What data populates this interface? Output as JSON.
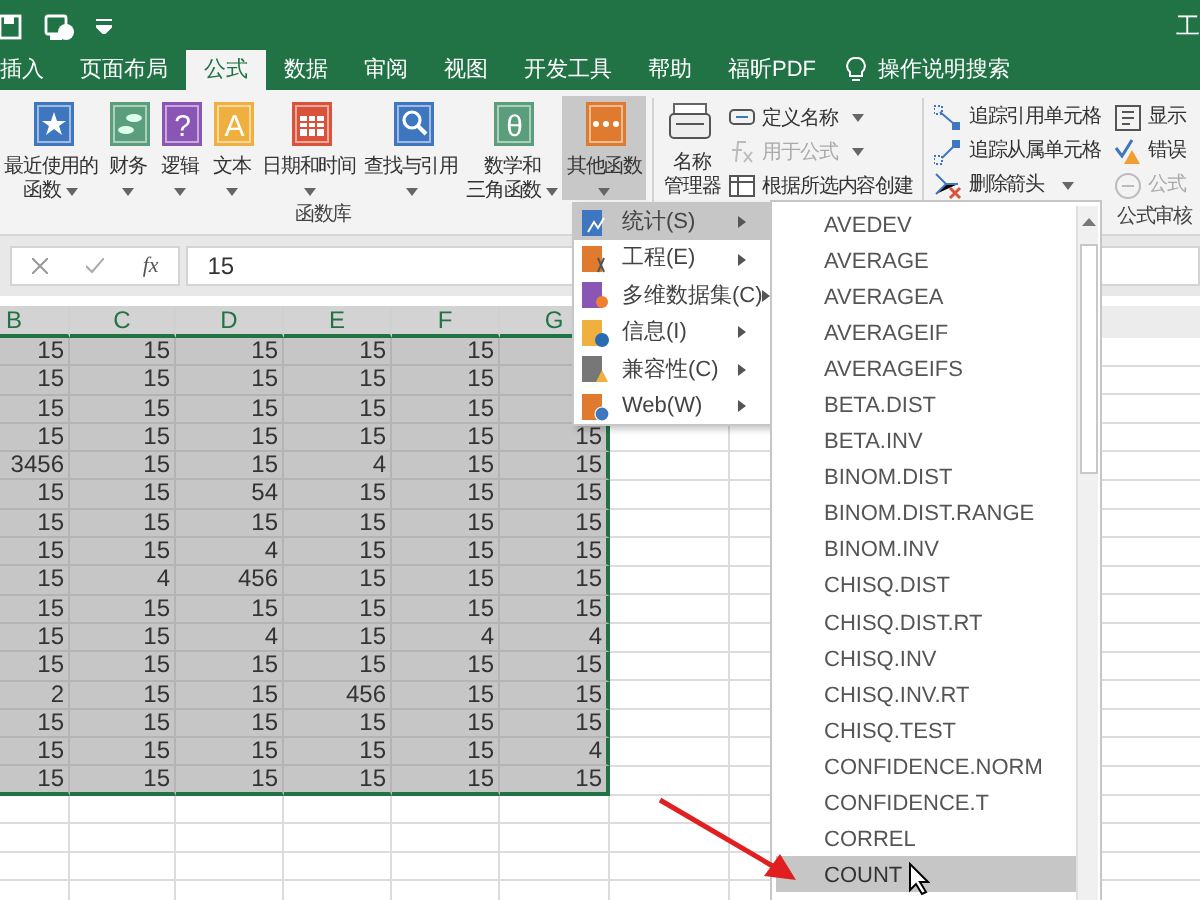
{
  "title_bar": {
    "title": "工"
  },
  "tabs": [
    {
      "label": "插入",
      "selected": false
    },
    {
      "label": "页面布局",
      "selected": false
    },
    {
      "label": "公式",
      "selected": true
    },
    {
      "label": "数据",
      "selected": false
    },
    {
      "label": "审阅",
      "selected": false
    },
    {
      "label": "视图",
      "selected": false
    },
    {
      "label": "开发工具",
      "selected": false
    },
    {
      "label": "帮助",
      "selected": false
    },
    {
      "label": "福昕PDF",
      "selected": false
    }
  ],
  "tell_me": {
    "label": "操作说明搜索"
  },
  "function_library": {
    "label": "函数库",
    "buttons": [
      {
        "lines": [
          "最近使用的",
          "函数"
        ],
        "selected": false
      },
      {
        "lines": [
          "财务"
        ],
        "selected": false
      },
      {
        "lines": [
          "逻辑"
        ],
        "glyph": "?",
        "selected": false
      },
      {
        "lines": [
          "文本"
        ],
        "glyph": "A",
        "selected": false
      },
      {
        "lines": [
          "日期和时间"
        ],
        "selected": false
      },
      {
        "lines": [
          "查找与引用"
        ],
        "selected": false
      },
      {
        "lines": [
          "数学和",
          "三角函数"
        ],
        "glyph": "θ",
        "selected": false
      },
      {
        "lines": [
          "其他函数"
        ],
        "selected": true
      }
    ]
  },
  "defined_names": {
    "manager": [
      "名称",
      "管理器"
    ],
    "items": [
      {
        "label": "定义名称",
        "dropdown": true,
        "disabled": false
      },
      {
        "label": "用于公式",
        "dropdown": true,
        "disabled": true
      },
      {
        "label": "根据所选内容创建",
        "dropdown": false,
        "disabled": false
      }
    ]
  },
  "formula_auditing": {
    "label": "公式审核",
    "items": [
      {
        "label": "追踪引用单元格",
        "disabled": false
      },
      {
        "label": "追踪从属单元格",
        "disabled": false
      },
      {
        "label": "删除箭头",
        "dropdown": true,
        "disabled": false
      }
    ],
    "more": [
      {
        "label": "显示",
        "disabled": false
      },
      {
        "label": "错误",
        "disabled": false
      },
      {
        "label": "公式",
        "disabled": true
      }
    ]
  },
  "formula_bar": {
    "fx_label": "fx",
    "value": "15"
  },
  "sheet": {
    "columns": [
      "B",
      "C",
      "D",
      "E",
      "F",
      "G"
    ],
    "rows": [
      {
        "selected": true,
        "cells": [
          "15",
          "15",
          "15",
          "15",
          "15"
        ]
      },
      {
        "selected": true,
        "cells": [
          "15",
          "15",
          "15",
          "15",
          "15"
        ]
      },
      {
        "selected": true,
        "cells": [
          "15",
          "15",
          "15",
          "15",
          "15"
        ]
      },
      {
        "selected": true,
        "cells": [
          "15",
          "15",
          "15",
          "15",
          "15",
          "15"
        ]
      },
      {
        "selected": true,
        "cells": [
          "3456",
          "15",
          "15",
          "4",
          "15",
          "15"
        ]
      },
      {
        "selected": true,
        "cells": [
          "15",
          "15",
          "54",
          "15",
          "15",
          "15"
        ]
      },
      {
        "selected": true,
        "cells": [
          "15",
          "15",
          "15",
          "15",
          "15",
          "15"
        ]
      },
      {
        "selected": true,
        "cells": [
          "15",
          "15",
          "4",
          "15",
          "15",
          "15"
        ]
      },
      {
        "selected": true,
        "cells": [
          "15",
          "4",
          "456",
          "15",
          "15",
          "15"
        ]
      },
      {
        "selected": true,
        "cells": [
          "15",
          "15",
          "15",
          "15",
          "15",
          "15"
        ]
      },
      {
        "selected": true,
        "cells": [
          "15",
          "15",
          "4",
          "15",
          "4",
          "4"
        ]
      },
      {
        "selected": true,
        "cells": [
          "15",
          "15",
          "15",
          "15",
          "15",
          "15"
        ]
      },
      {
        "selected": true,
        "cells": [
          "2",
          "15",
          "15",
          "456",
          "15",
          "15"
        ]
      },
      {
        "selected": true,
        "cells": [
          "15",
          "15",
          "15",
          "15",
          "15",
          "15"
        ]
      },
      {
        "selected": true,
        "cells": [
          "15",
          "15",
          "15",
          "15",
          "15",
          "4"
        ]
      },
      {
        "selected": true,
        "cells": [
          "15",
          "15",
          "15",
          "15",
          "15",
          "15"
        ]
      }
    ]
  },
  "function_menu": {
    "items": [
      {
        "label": "统计(S)",
        "selected": true
      },
      {
        "label": "工程(E)",
        "selected": false
      },
      {
        "label": "多维数据集(C)",
        "selected": false
      },
      {
        "label": "信息(I)",
        "selected": false
      },
      {
        "label": "兼容性(C)",
        "selected": false
      },
      {
        "label": "Web(W)",
        "selected": false
      }
    ]
  },
  "statistical_menu": {
    "items": [
      {
        "label": "AVEDEV",
        "selected": false
      },
      {
        "label": "AVERAGE",
        "selected": false
      },
      {
        "label": "AVERAGEA",
        "selected": false
      },
      {
        "label": "AVERAGEIF",
        "selected": false
      },
      {
        "label": "AVERAGEIFS",
        "selected": false
      },
      {
        "label": "BETA.DIST",
        "selected": false
      },
      {
        "label": "BETA.INV",
        "selected": false
      },
      {
        "label": "BINOM.DIST",
        "selected": false
      },
      {
        "label": "BINOM.DIST.RANGE",
        "selected": false
      },
      {
        "label": "BINOM.INV",
        "selected": false
      },
      {
        "label": "CHISQ.DIST",
        "selected": false
      },
      {
        "label": "CHISQ.DIST.RT",
        "selected": false
      },
      {
        "label": "CHISQ.INV",
        "selected": false
      },
      {
        "label": "CHISQ.INV.RT",
        "selected": false
      },
      {
        "label": "CHISQ.TEST",
        "selected": false
      },
      {
        "label": "CONFIDENCE.NORM",
        "selected": false
      },
      {
        "label": "CONFIDENCE.T",
        "selected": false
      },
      {
        "label": "CORREL",
        "selected": false
      },
      {
        "label": "COUNT",
        "selected": true
      }
    ]
  }
}
